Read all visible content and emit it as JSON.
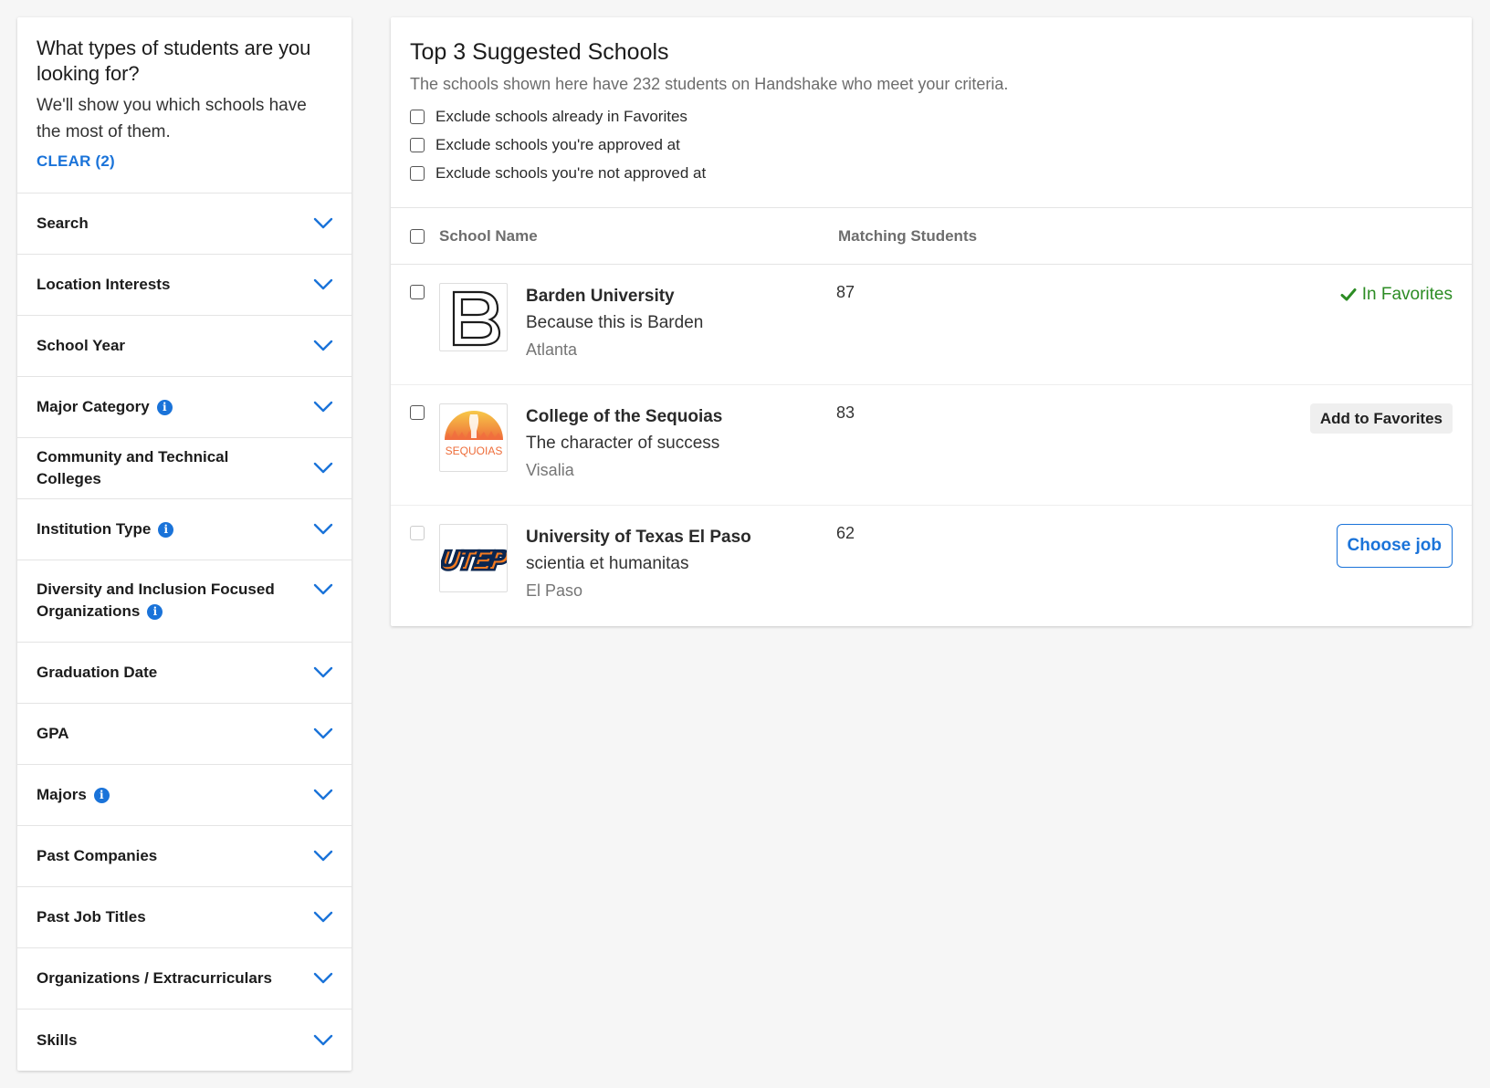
{
  "sidebar": {
    "title": "What types of students are you looking for?",
    "subtitle": "We'll show you which schools have the most of them.",
    "clear_label": "CLEAR (2)",
    "filters": [
      {
        "label": "Search",
        "info": false
      },
      {
        "label": "Location Interests",
        "info": false
      },
      {
        "label": "School Year",
        "info": false
      },
      {
        "label": "Major Category",
        "info": true
      },
      {
        "label": "Community and Technical Colleges",
        "info": false
      },
      {
        "label": "Institution Type",
        "info": true
      },
      {
        "label": "Diversity and Inclusion Focused Organizations",
        "info": true
      },
      {
        "label": "Graduation Date",
        "info": false
      },
      {
        "label": "GPA",
        "info": false
      },
      {
        "label": "Majors",
        "info": true
      },
      {
        "label": "Past Companies",
        "info": false
      },
      {
        "label": "Past Job Titles",
        "info": false
      },
      {
        "label": "Organizations / Extracurriculars",
        "info": false
      },
      {
        "label": "Skills",
        "info": false
      }
    ]
  },
  "main": {
    "title": "Top 3 Suggested Schools",
    "subtitle": "The schools shown here have 232 students on Handshake who meet your criteria.",
    "options": [
      "Exclude schools already in Favorites",
      "Exclude schools you're approved at",
      "Exclude schools you're not approved at"
    ],
    "columns": {
      "name": "School Name",
      "matching": "Matching Students"
    },
    "schools": [
      {
        "name": "Barden University",
        "tagline": "Because this is Barden",
        "location": "Atlanta",
        "count": "87",
        "action": "In Favorites"
      },
      {
        "name": "College of the Sequoias",
        "tagline": "The character of success",
        "location": "Visalia",
        "count": "83",
        "action": "Add to Favorites",
        "logo_text": "SEQUOIAS"
      },
      {
        "name": "University of Texas El Paso",
        "tagline": "scientia et humanitas",
        "location": "El Paso",
        "count": "62",
        "action": "Choose job",
        "logo_text": "UTEP"
      }
    ]
  },
  "colors": {
    "accent": "#1a73d9",
    "success": "#2c8c24",
    "background": "#f6f6f6"
  }
}
